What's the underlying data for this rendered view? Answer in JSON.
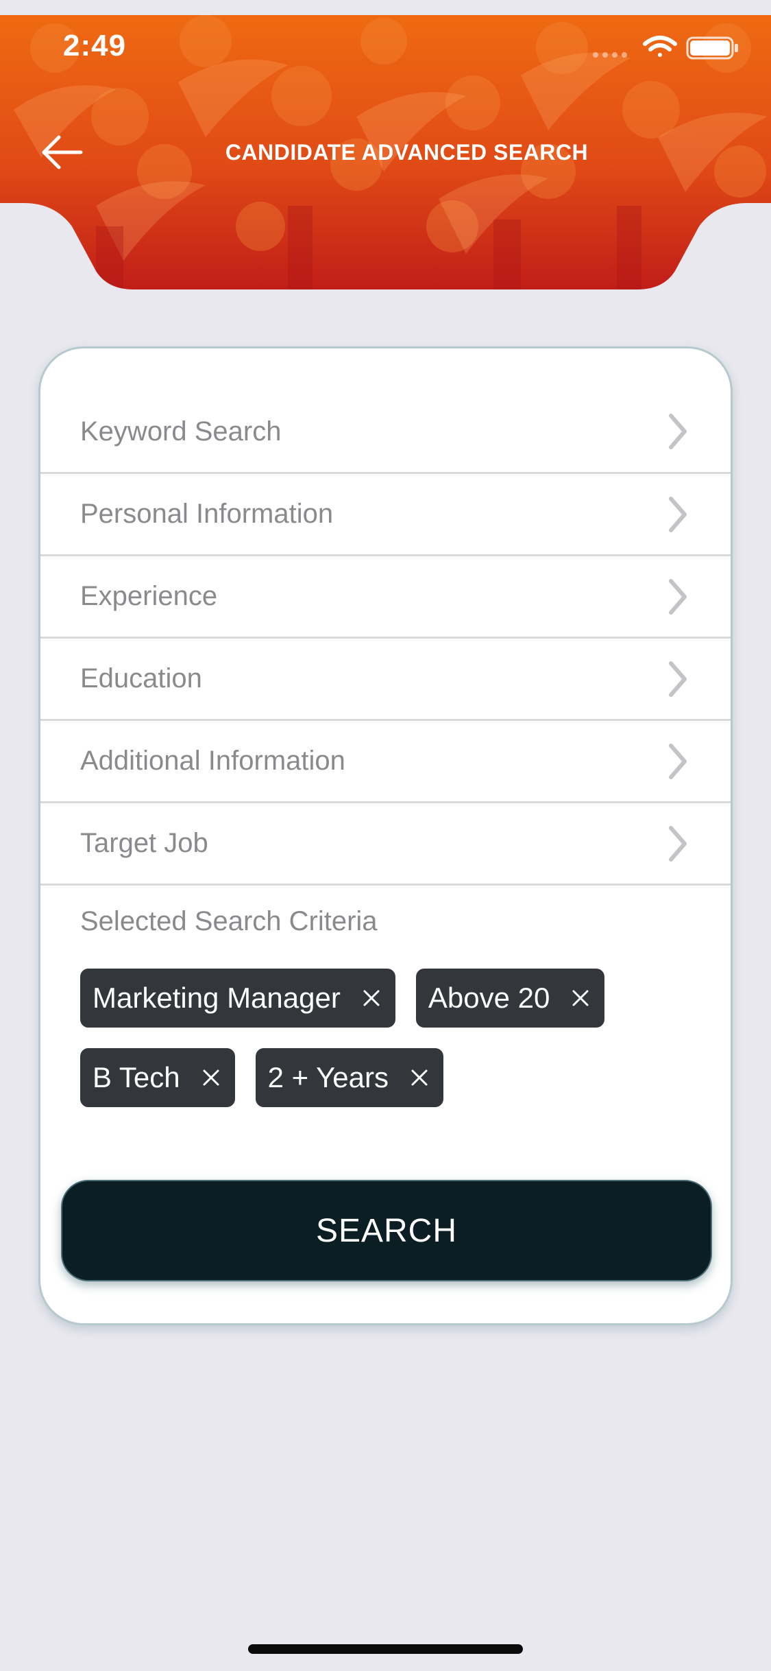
{
  "status_bar": {
    "time": "2:49"
  },
  "header": {
    "title": "CANDIDATE ADVANCED SEARCH"
  },
  "menu": {
    "items": [
      {
        "label": "Keyword Search"
      },
      {
        "label": "Personal Information"
      },
      {
        "label": "Experience"
      },
      {
        "label": "Education"
      },
      {
        "label": "Additional Information"
      },
      {
        "label": "Target Job"
      }
    ]
  },
  "criteria": {
    "title": "Selected Search Criteria",
    "chips": [
      {
        "label": "Marketing Manager"
      },
      {
        "label": "Above 20"
      },
      {
        "label": "B Tech"
      },
      {
        "label": "2 + Years"
      }
    ]
  },
  "search_button": {
    "label": "SEARCH"
  },
  "colors": {
    "header_orange": "#e8611b",
    "header_red": "#c4201a",
    "background": "#e9e8ef",
    "chip": "#33363b",
    "search_button": "#0a1e24"
  },
  "icons": [
    "back-arrow-icon",
    "chevron-right-icon",
    "close-icon",
    "signal-icon",
    "wifi-icon",
    "battery-icon"
  ]
}
